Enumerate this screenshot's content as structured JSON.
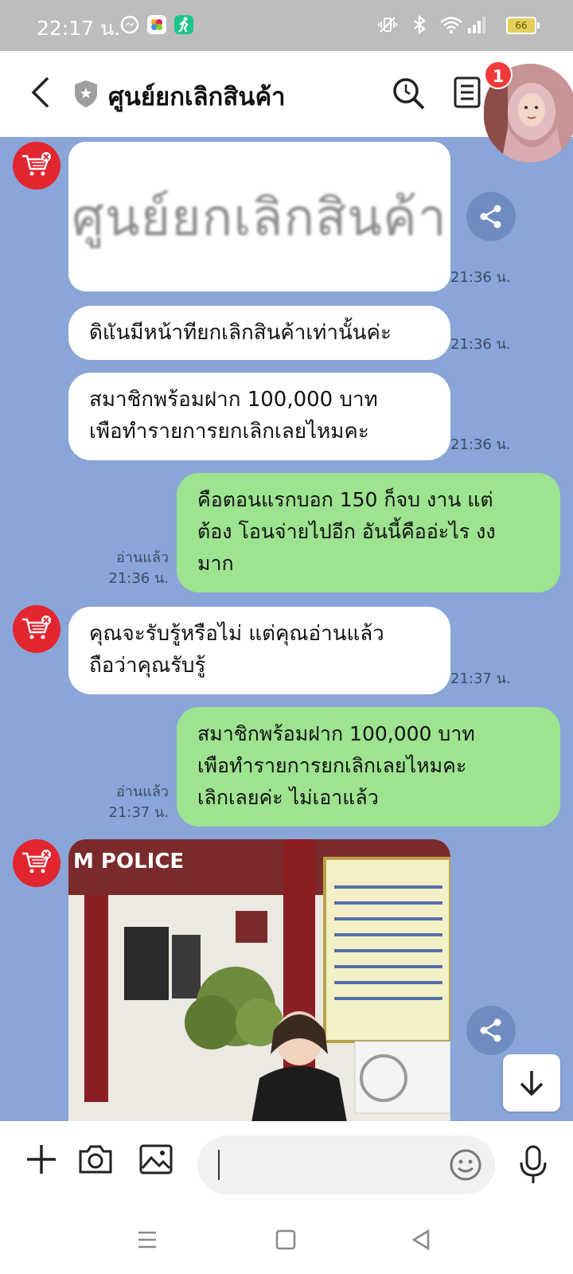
{
  "status_bar": {
    "time": "22:17 น.",
    "battery": "66",
    "icons": [
      "messenger-icon",
      "photos-icon",
      "fitness-icon",
      "vibrate-icon",
      "bluetooth-icon",
      "wifi-icon",
      "signal-icon",
      "battery-icon"
    ]
  },
  "header": {
    "title": "ศูนย์ยกเลิกสินค้า",
    "notification_count": "1"
  },
  "chat": {
    "image_card_text": "ศูนย์ยกเลิกสินค้า",
    "messages": [
      {
        "side": "in",
        "text": "ดิแันมีหน้าทียกเลิกสินค้าเท่านั้นค่ะ",
        "time": "21:36 น."
      },
      {
        "side": "in",
        "text": "สมาชิกพร้อมฝาก 100,000 บาท\nเพือทํารายการยกเลิกเลยไหมคะ",
        "time": "21:36 น."
      },
      {
        "side": "out",
        "text": "คือตอนแรกบอก 150 ก็จบ งาน แต่\nต้อง โอนจ่ายไปอีก อันนี้คืออ่ะไร งง\nมาก",
        "read": "อ่านแล้ว",
        "time": "21:36 น."
      },
      {
        "side": "in",
        "text": "คุณจะรับรู้หรือไม่ แต่คุณอ่านแล้ว\nถือว่าคุณรับรู้",
        "time": "21:37 น."
      },
      {
        "side": "out",
        "text": "สมาชิกพร้อมฝาก 100,000 บาท\nเพือทํารายการยกเลิกเลยไหมคะ\nเลิกเลยค่ะ ไม่เอาแล้ว",
        "read": "อ่านแล้ว",
        "time": "21:37 น."
      }
    ],
    "image_time": "21:36 น.",
    "photo_sign_text": "M POLICE"
  },
  "input": {
    "placeholder": ""
  },
  "colors": {
    "chat_bg": "#8aa5d8",
    "outgoing_bubble": "#9de390",
    "incoming_bubble": "#ffffff",
    "bot_avatar": "#e2252f",
    "badge": "#f23a3a"
  }
}
